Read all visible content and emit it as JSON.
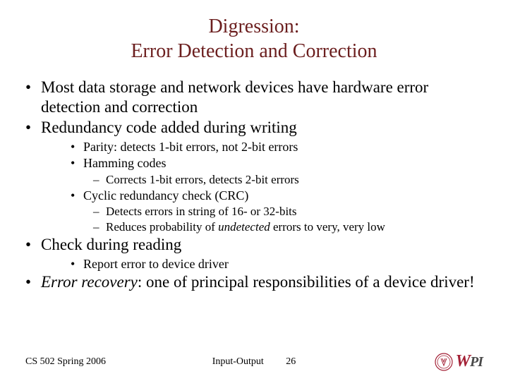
{
  "title_line1": "Digression:",
  "title_line2": "Error Detection and Correction",
  "bullets": {
    "b1": "Most data storage and network devices have hardware error detection and correction",
    "b2": "Redundancy code added during writing",
    "b2_1": "Parity: detects 1-bit errors, not 2-bit errors",
    "b2_2": "Hamming codes",
    "b2_2_1": "Corrects 1-bit errors, detects 2-bit errors",
    "b2_3": "Cyclic redundancy check (CRC)",
    "b2_3_1": "Detects errors in string of 16- or 32-bits",
    "b2_3_2_a": "Reduces probability of ",
    "b2_3_2_b": "undetected",
    "b2_3_2_c": " errors to very, very low",
    "b3": "Check during reading",
    "b3_1": "Report error to device driver",
    "b4_a": "Error recovery",
    "b4_b": ": one of principal responsibilities of a device driver!"
  },
  "footer": {
    "course": "CS 502 Spring 2006",
    "section": "Input-Output",
    "page": "26",
    "logo_letters": {
      "w": "W",
      "pi": "PI"
    }
  }
}
